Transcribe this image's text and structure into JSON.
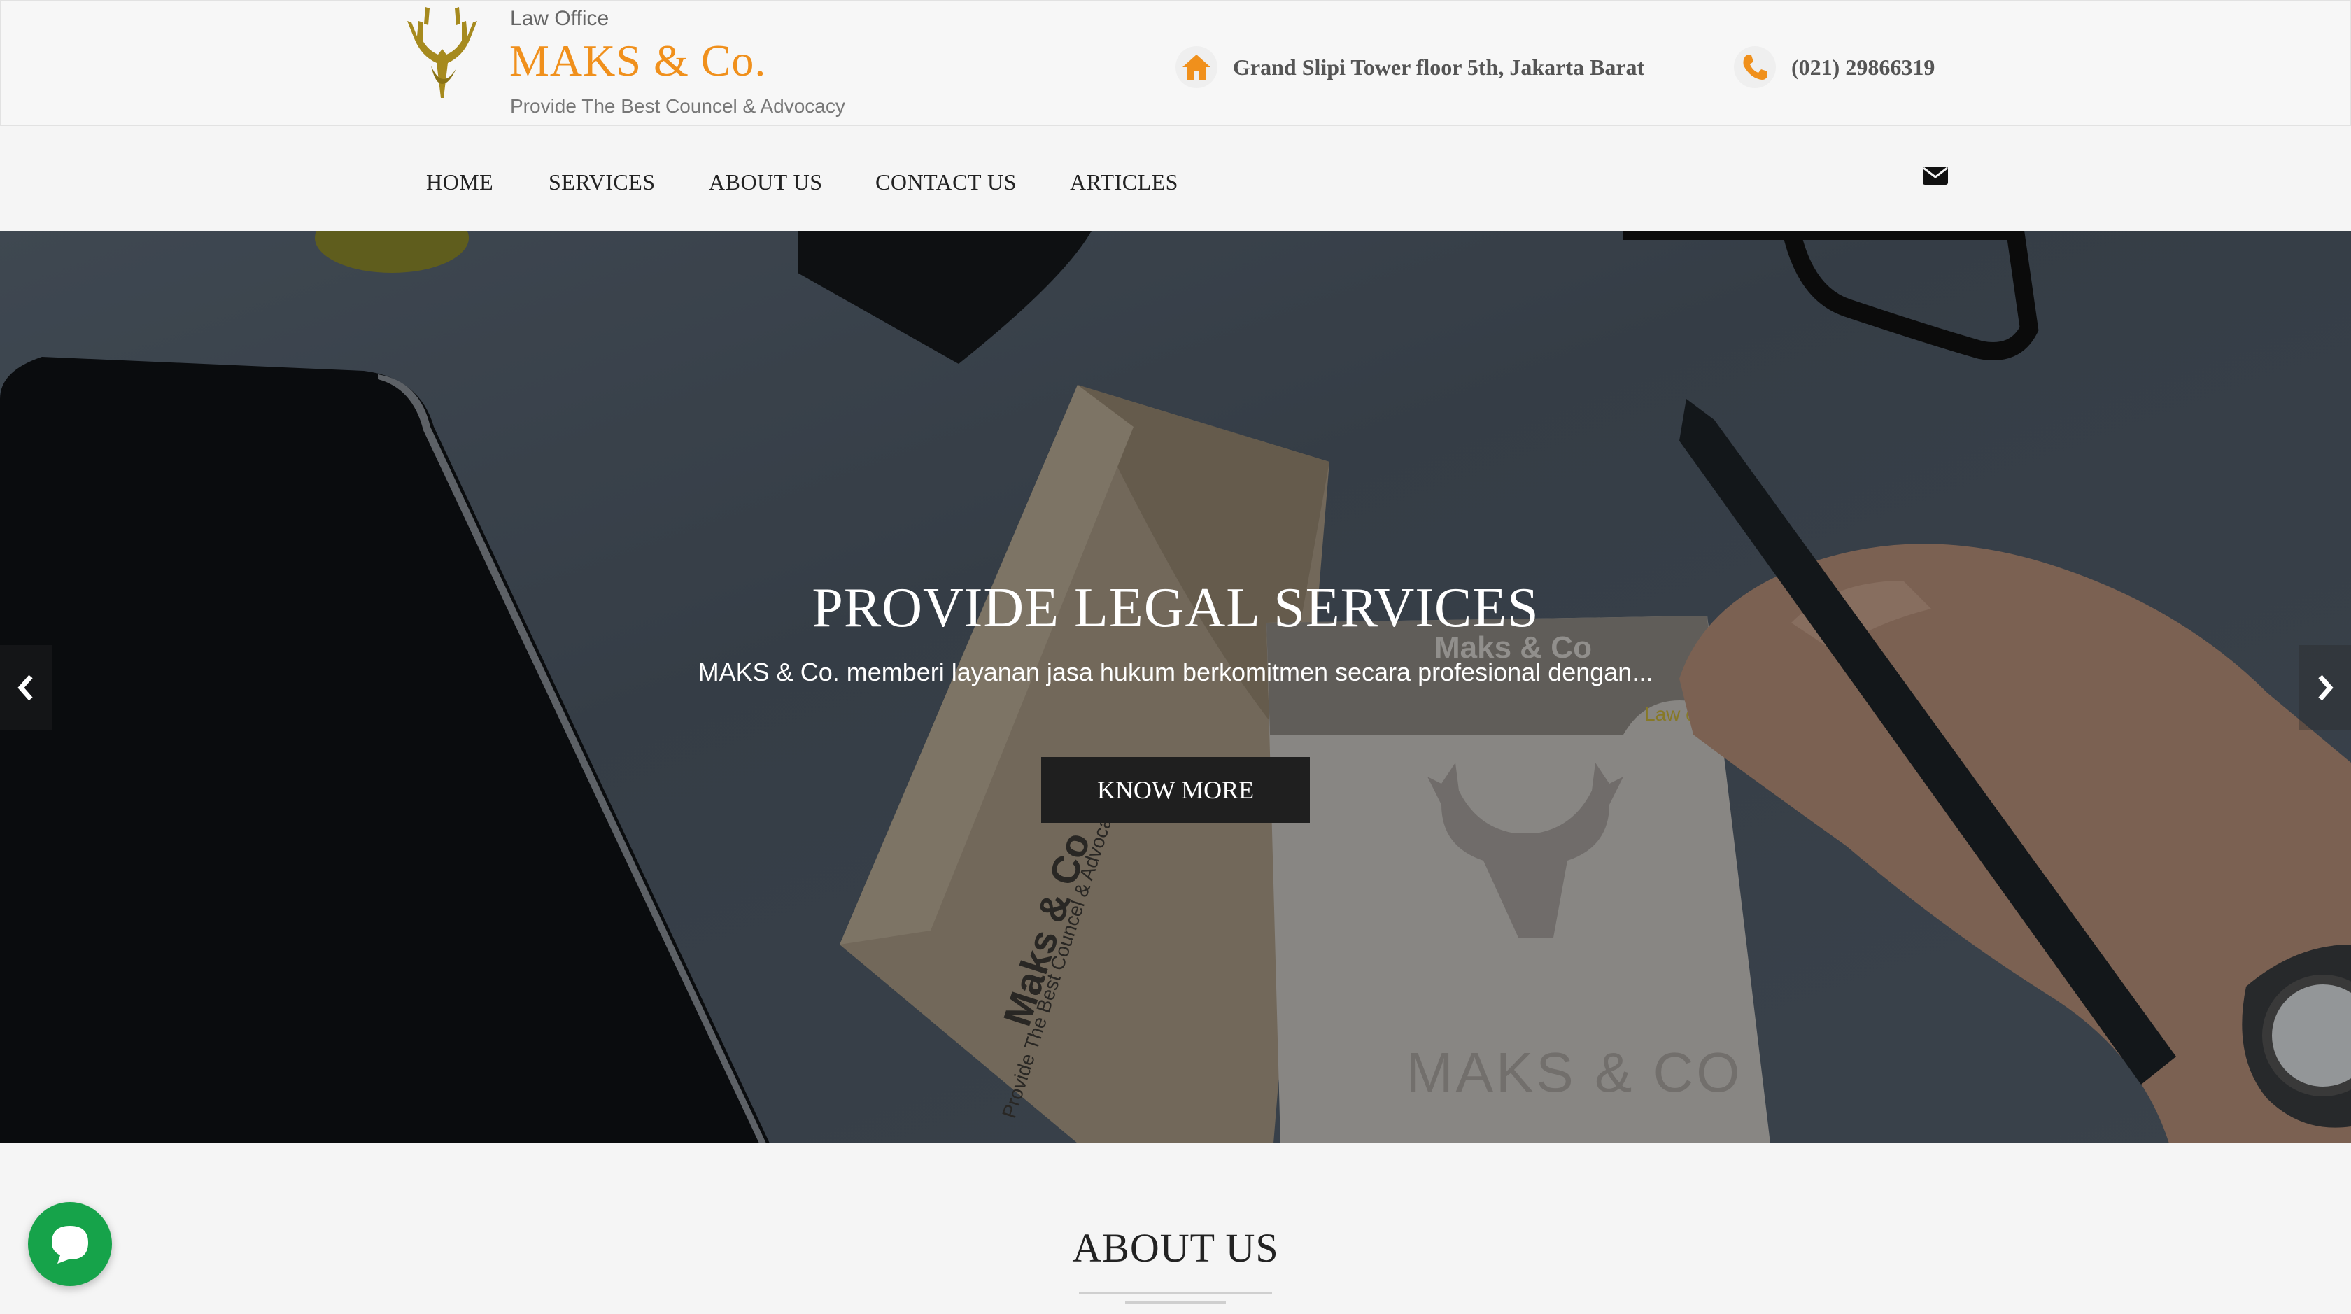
{
  "header": {
    "brand_small": "Law Office",
    "brand_name": "MAKS & Co.",
    "brand_tagline": "Provide The Best Councel & Advocacy",
    "address": "Grand Slipi Tower floor 5th, Jakarta Barat",
    "phone": "(021) 29866319",
    "accent_color": "#f0901c"
  },
  "nav": {
    "items": [
      {
        "label": "HOME"
      },
      {
        "label": "SERVICES"
      },
      {
        "label": "ABOUT US"
      },
      {
        "label": "CONTACT US"
      },
      {
        "label": "ARTICLES"
      }
    ],
    "mail_icon": "envelope-icon"
  },
  "hero": {
    "title": "PROVIDE LEGAL SERVICES",
    "subtitle": "MAKS & Co. memberi layanan jasa hukum berkomitmen secara profesional dengan...",
    "button_label": "KNOW MORE",
    "prev_icon": "chevron-left-icon",
    "next_icon": "chevron-right-icon"
  },
  "about": {
    "title": "ABOUT US"
  },
  "chat": {
    "icon": "chat-bubble-icon",
    "color": "#16a34a"
  }
}
